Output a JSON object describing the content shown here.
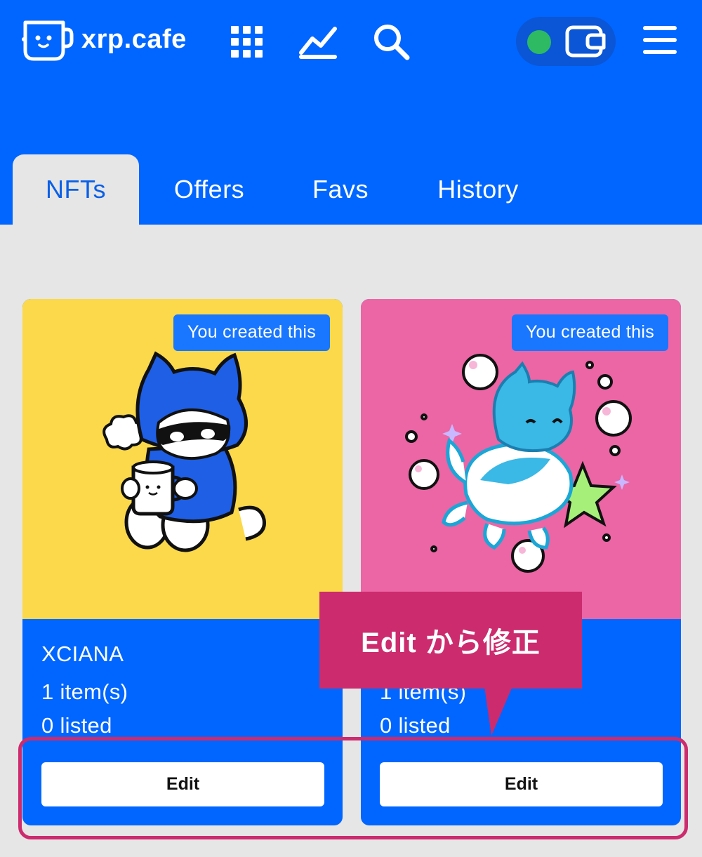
{
  "header": {
    "logo_text": "xrp.cafe",
    "icons": [
      "apps-grid-icon",
      "chart-icon",
      "search-icon",
      "wallet-icon",
      "menu-icon"
    ],
    "wallet_status_color": "#2dba63",
    "brand_color": "#0066ff"
  },
  "tabs": [
    {
      "label": "NFTs",
      "active": true
    },
    {
      "label": "Offers",
      "active": false
    },
    {
      "label": "Favs",
      "active": false
    },
    {
      "label": "History",
      "active": false
    }
  ],
  "cards": [
    {
      "badge": "You created this",
      "name": "XCIANA",
      "items": "1 item(s)",
      "listed": "0 listed",
      "button_label": "Edit",
      "image_bg": "#fbd94a"
    },
    {
      "badge": "You created this",
      "name": "",
      "items": "1 item(s)",
      "listed": "0 listed",
      "button_label": "Edit",
      "image_bg": "#ec65a5"
    }
  ],
  "annotation": {
    "text": "Edit から修正",
    "color": "#cc2b6e"
  }
}
